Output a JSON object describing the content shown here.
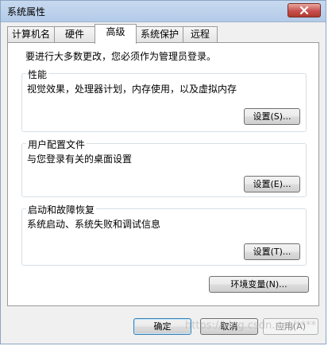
{
  "window": {
    "title": "系统属性"
  },
  "tabs": [
    {
      "label": "计算机名",
      "active": false
    },
    {
      "label": "硬件",
      "active": false
    },
    {
      "label": "高级",
      "active": true
    },
    {
      "label": "系统保护",
      "active": false
    },
    {
      "label": "远程",
      "active": false
    }
  ],
  "main": {
    "intro": "要进行大多数更改，您必须作为管理员登录。",
    "performance": {
      "title": "性能",
      "description": "视觉效果，处理器计划，内存使用，以及虚拟内存",
      "button": "设置(S)..."
    },
    "user_profiles": {
      "title": "用户配置文件",
      "description": "与您登录有关的桌面设置",
      "button": "设置(E)..."
    },
    "startup_recovery": {
      "title": "启动和故障恢复",
      "description": "系统启动、系统失败和调试信息",
      "button": "设置(T)..."
    },
    "env_button": "环境变量(N)..."
  },
  "footer": {
    "ok": "确定",
    "cancel": "取消",
    "apply": "应用(A)"
  },
  "watermark": "https://blog.csdn.net/****",
  "colors": {
    "titlebar": "#c7d9ef",
    "close_button": "#c75050",
    "dialog_bg": "#f0f0f0",
    "panel_bg": "#ffffff",
    "group_border": "#d5dfe5"
  }
}
